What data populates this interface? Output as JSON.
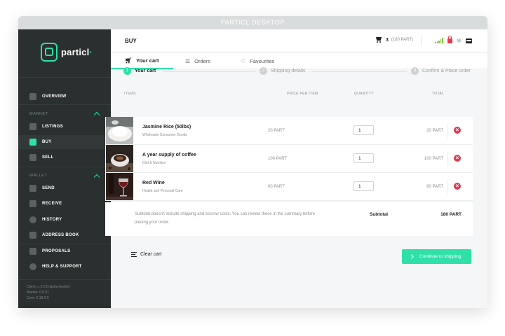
{
  "app": {
    "title": "PARTICL DESKTOP"
  },
  "sidebar": {
    "logo_text": "particl",
    "overview": "OVERVIEW",
    "market_title": "MARKET",
    "market_items": [
      "LISTINGS",
      "BUY",
      "SELL"
    ],
    "wallet_title": "WALLET",
    "wallet_items": [
      "SEND",
      "RECEIVE",
      "HISTORY",
      "ADDRESS BOOK"
    ],
    "extra_items": [
      "PROPOSALS",
      "HELP & SUPPORT"
    ],
    "active_item": "BUY",
    "versions": [
      "Client: ≥ 2.0.0-alpha-testnet",
      "Market: 0.0.51",
      "Core: 0.18.0.5"
    ]
  },
  "header": {
    "title": "BUY",
    "cart_count": "3",
    "cart_total": "(180 PART)"
  },
  "tabs": [
    {
      "label": "Your cart",
      "icon": "cart-icon",
      "active": true
    },
    {
      "label": "Orders",
      "icon": "list-icon",
      "active": false
    },
    {
      "label": "Favourites",
      "icon": "heart-icon",
      "active": false
    }
  ],
  "steps": [
    {
      "number": "1",
      "label": "Your cart",
      "active": true
    },
    {
      "number": "2",
      "label": "Shipping details",
      "active": false
    },
    {
      "number": "3",
      "label": "Confirm & Place order",
      "active": false
    }
  ],
  "table": {
    "headers": [
      "ITEMS",
      "PRICE PER ITEM",
      "QUANTITY",
      "TOTAL"
    ],
    "rows": [
      {
        "name": "Jasmine Rice (50lbs)",
        "category": "Wholesale Consumer Goods",
        "price": "20 PART",
        "quantity": "1",
        "total": "20 PART"
      },
      {
        "name": "A year supply of coffee",
        "category": "Diet & Nutrition",
        "price": "100 PART",
        "quantity": "1",
        "total": "100 PART"
      },
      {
        "name": "Red Wine",
        "category": "Health and Personal Care",
        "price": "60 PART",
        "quantity": "1",
        "total": "60 PART"
      }
    ]
  },
  "summary": {
    "note": "Subtotal doesn't include shipping and escrow costs. You can review these in the summary before placing your order.",
    "subtotal_label": "Subtotal",
    "subtotal_value": "180 PART"
  },
  "actions": {
    "clear_cart": "Clear cart",
    "continue": "Continue to shipping"
  },
  "colors": {
    "accent": "#2fe0a9",
    "sidebar_bg": "#2a302f",
    "danger": "#e53950",
    "signal": "#7cc341"
  }
}
